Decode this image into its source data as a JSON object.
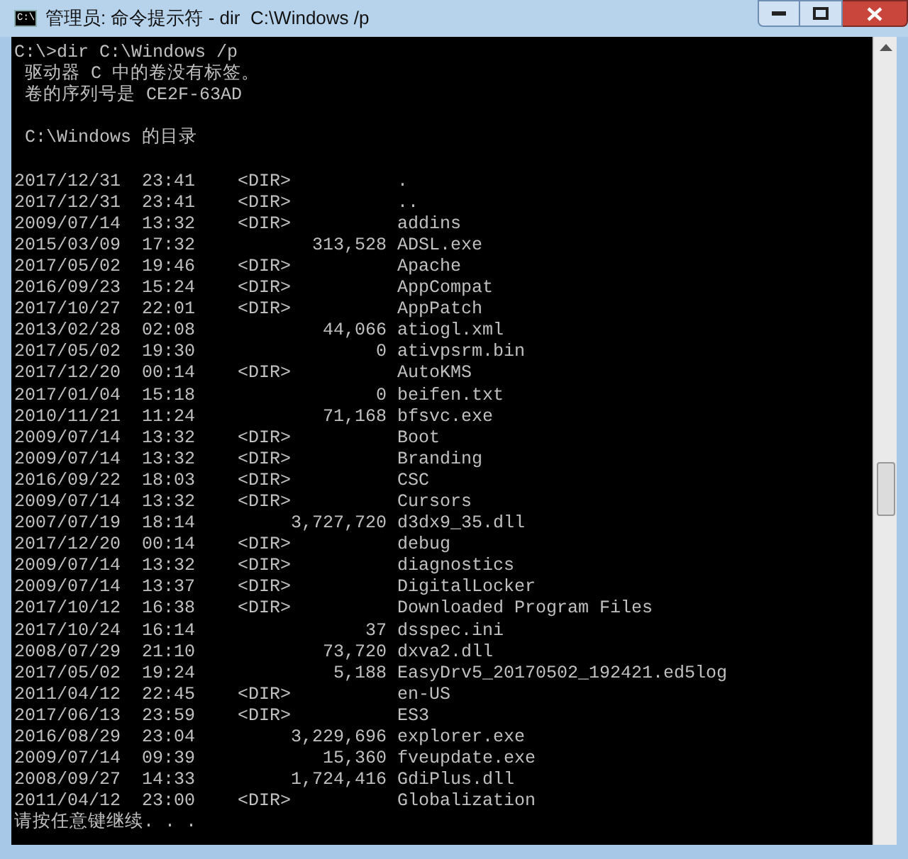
{
  "window": {
    "title": "管理员: 命令提示符 - dir  C:\\Windows /p",
    "icon_text": "C:\\"
  },
  "console": {
    "command": "C:\\>dir C:\\Windows /p",
    "volume_lines": [
      "驱动器 C 中的卷没有标签。",
      "卷的序列号是 CE2F-63AD"
    ],
    "directory_header": "C:\\Windows 的目录",
    "rows": [
      {
        "date": "2017/12/31",
        "time": "23:41",
        "kind": "dir",
        "tag": "<DIR>",
        "name": "."
      },
      {
        "date": "2017/12/31",
        "time": "23:41",
        "kind": "dir",
        "tag": "<DIR>",
        "name": ".."
      },
      {
        "date": "2009/07/14",
        "time": "13:32",
        "kind": "dir",
        "tag": "<DIR>",
        "name": "addins"
      },
      {
        "date": "2015/03/09",
        "time": "17:32",
        "kind": "file",
        "size": "313,528",
        "name": "ADSL.exe"
      },
      {
        "date": "2017/05/02",
        "time": "19:46",
        "kind": "dir",
        "tag": "<DIR>",
        "name": "Apache"
      },
      {
        "date": "2016/09/23",
        "time": "15:24",
        "kind": "dir",
        "tag": "<DIR>",
        "name": "AppCompat"
      },
      {
        "date": "2017/10/27",
        "time": "22:01",
        "kind": "dir",
        "tag": "<DIR>",
        "name": "AppPatch"
      },
      {
        "date": "2013/02/28",
        "time": "02:08",
        "kind": "file",
        "size": "44,066",
        "name": "atiogl.xml"
      },
      {
        "date": "2017/05/02",
        "time": "19:30",
        "kind": "file",
        "size": "0",
        "name": "ativpsrm.bin"
      },
      {
        "date": "2017/12/20",
        "time": "00:14",
        "kind": "dir",
        "tag": "<DIR>",
        "name": "AutoKMS"
      },
      {
        "date": "2017/01/04",
        "time": "15:18",
        "kind": "file",
        "size": "0",
        "name": "beifen.txt"
      },
      {
        "date": "2010/11/21",
        "time": "11:24",
        "kind": "file",
        "size": "71,168",
        "name": "bfsvc.exe"
      },
      {
        "date": "2009/07/14",
        "time": "13:32",
        "kind": "dir",
        "tag": "<DIR>",
        "name": "Boot"
      },
      {
        "date": "2009/07/14",
        "time": "13:32",
        "kind": "dir",
        "tag": "<DIR>",
        "name": "Branding"
      },
      {
        "date": "2016/09/22",
        "time": "18:03",
        "kind": "dir",
        "tag": "<DIR>",
        "name": "CSC"
      },
      {
        "date": "2009/07/14",
        "time": "13:32",
        "kind": "dir",
        "tag": "<DIR>",
        "name": "Cursors"
      },
      {
        "date": "2007/07/19",
        "time": "18:14",
        "kind": "file",
        "size": "3,727,720",
        "name": "d3dx9_35.dll"
      },
      {
        "date": "2017/12/20",
        "time": "00:14",
        "kind": "dir",
        "tag": "<DIR>",
        "name": "debug"
      },
      {
        "date": "2009/07/14",
        "time": "13:32",
        "kind": "dir",
        "tag": "<DIR>",
        "name": "diagnostics"
      },
      {
        "date": "2009/07/14",
        "time": "13:37",
        "kind": "dir",
        "tag": "<DIR>",
        "name": "DigitalLocker"
      },
      {
        "date": "2017/10/12",
        "time": "16:38",
        "kind": "dir",
        "tag": "<DIR>",
        "name": "Downloaded Program Files"
      },
      {
        "date": "2017/10/24",
        "time": "16:14",
        "kind": "file",
        "size": "37",
        "name": "dsspec.ini"
      },
      {
        "date": "2008/07/29",
        "time": "21:10",
        "kind": "file",
        "size": "73,720",
        "name": "dxva2.dll"
      },
      {
        "date": "2017/05/02",
        "time": "19:24",
        "kind": "file",
        "size": "5,188",
        "name": "EasyDrv5_20170502_192421.ed5log"
      },
      {
        "date": "2011/04/12",
        "time": "22:45",
        "kind": "dir",
        "tag": "<DIR>",
        "name": "en-US"
      },
      {
        "date": "2017/06/13",
        "time": "23:59",
        "kind": "dir",
        "tag": "<DIR>",
        "name": "ES3"
      },
      {
        "date": "2016/08/29",
        "time": "23:04",
        "kind": "file",
        "size": "3,229,696",
        "name": "explorer.exe"
      },
      {
        "date": "2009/07/14",
        "time": "09:39",
        "kind": "file",
        "size": "15,360",
        "name": "fveupdate.exe"
      },
      {
        "date": "2008/09/27",
        "time": "14:33",
        "kind": "file",
        "size": "1,724,416",
        "name": "GdiPlus.dll"
      },
      {
        "date": "2011/04/12",
        "time": "23:00",
        "kind": "dir",
        "tag": "<DIR>",
        "name": "Globalization"
      }
    ],
    "pause_prompt": "请按任意键继续. . ."
  }
}
